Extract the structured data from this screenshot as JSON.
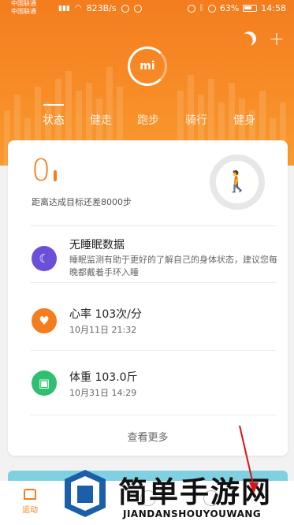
{
  "status_bar": {
    "carrier1": "中国联通",
    "carrier2": "中国联通",
    "net_speed": "823B/s",
    "battery": "63%",
    "time": "14:58"
  },
  "header": {
    "logo_text": "mi",
    "tabs": [
      "状态",
      "健走",
      "跑步",
      "骑行",
      "健身"
    ],
    "active_tab": 0
  },
  "summary": {
    "steps": "0",
    "goal_note": "距离达成目标还差8000步"
  },
  "rows": [
    {
      "title": "无睡眠数据",
      "subtitle": "睡眠监测有助于更好的了解自己的身体状态，建议您每晚都戴着手环入睡",
      "color": "#6b4fd8",
      "icon": "moon-icon"
    },
    {
      "title": "心率 103次/分",
      "subtitle": "10月11日 21:32",
      "color": "#f47d1e",
      "icon": "heart-icon"
    },
    {
      "title": "体重 103.0斤",
      "subtitle": "10月31日 14:29",
      "color": "#2fbf71",
      "icon": "scale-icon"
    }
  ],
  "see_more": "查看更多",
  "bottom_nav": {
    "home_label": "运动"
  },
  "watermark": {
    "title": "简单手游网",
    "subtitle": "JIANDANSHOUYOUWANG"
  }
}
